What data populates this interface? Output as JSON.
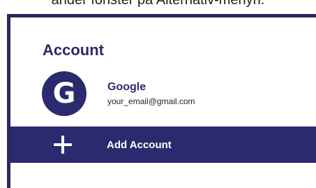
{
  "top_text": "ander fönster på Alternativ-menyn.",
  "settings": {
    "section_title": "Account",
    "account": {
      "avatar_letter": "G",
      "name": "Google",
      "email": "your_email@gmail.com"
    },
    "add_account_label": "Add Account"
  },
  "colors": {
    "accent": "#2b2a6e",
    "text_dark": "#1f1f1f",
    "background": "#ffffff"
  },
  "icons": {
    "avatar": "google-g-icon",
    "add": "plus-icon"
  }
}
